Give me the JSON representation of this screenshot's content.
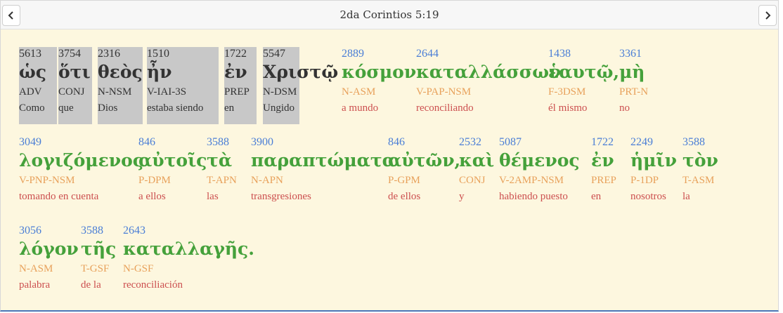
{
  "header": {
    "title": "2da Corintios 5:19",
    "prev_icon": "chevron-left-icon",
    "next_icon": "chevron-right-icon"
  },
  "colors": {
    "strong_number": "#4a7ed6",
    "greek_word": "#45a13b",
    "morphology": "#e8a15b",
    "gloss": "#cc4f4f",
    "selected_bg": "#c8c8c8",
    "panel_bg": "#fdf7df"
  },
  "rows": [
    [
      {
        "strong": "5613",
        "greek": "ὡς",
        "morph": "ADV",
        "gloss": "Como",
        "selected": true
      },
      {
        "strong": "3754",
        "greek": "ὅτι",
        "morph": "CONJ",
        "gloss": "que",
        "selected": true
      },
      {
        "strong": "2316",
        "greek": "θεὸς",
        "morph": "N-NSM",
        "gloss": "Dios",
        "selected": true
      },
      {
        "strong": "1510",
        "greek": "ἦν",
        "morph": "V-IAI-3S",
        "gloss": "estaba siendo",
        "selected": true
      },
      {
        "strong": "1722",
        "greek": "ἐν",
        "morph": "PREP",
        "gloss": "en",
        "selected": true
      },
      {
        "strong": "5547",
        "greek": "Χριστῷ",
        "morph": "N-DSM",
        "gloss": "Ungido",
        "selected": true
      },
      {
        "strong": "2889",
        "greek": "κόσμον",
        "morph": "N-ASM",
        "gloss": "a mundo",
        "selected": false
      },
      {
        "strong": "2644",
        "greek": "καταλλάσσων",
        "morph": "V-PAP-NSM",
        "gloss": "reconciliando",
        "selected": false
      },
      {
        "strong": "1438",
        "greek": "ἑαυτῷ,",
        "morph": "F-3DSM",
        "gloss": "él mismo",
        "selected": false
      },
      {
        "strong": "3361",
        "greek": "μὴ",
        "morph": "PRT-N",
        "gloss": "no",
        "selected": false
      }
    ],
    [
      {
        "strong": "3049",
        "greek": "λογιζόμενος",
        "morph": "V-PNP-NSM",
        "gloss": "tomando en cuenta",
        "selected": false
      },
      {
        "strong": "846",
        "greek": "αὐτοῖς",
        "morph": "P-DPM",
        "gloss": "a ellos",
        "selected": false
      },
      {
        "strong": "3588",
        "greek": "τὰ",
        "morph": "T-APN",
        "gloss": "las",
        "selected": false
      },
      {
        "strong": "3900",
        "greek": "παραπτώματα",
        "morph": "N-APN",
        "gloss": "transgresiones",
        "selected": false
      },
      {
        "strong": "846",
        "greek": "αὐτῶν,",
        "morph": "P-GPM",
        "gloss": "de ellos",
        "selected": false
      },
      {
        "strong": "2532",
        "greek": "καὶ",
        "morph": "CONJ",
        "gloss": "y",
        "selected": false
      },
      {
        "strong": "5087",
        "greek": "θέμενος",
        "morph": "V-2AMP-NSM",
        "gloss": "habiendo puesto",
        "selected": false
      },
      {
        "strong": "1722",
        "greek": "ἐν",
        "morph": "PREP",
        "gloss": "en",
        "selected": false
      },
      {
        "strong": "2249",
        "greek": "ἡμῖν",
        "morph": "P-1DP",
        "gloss": "nosotros",
        "selected": false
      },
      {
        "strong": "3588",
        "greek": "τὸν",
        "morph": "T-ASM",
        "gloss": "la",
        "selected": false
      }
    ],
    [
      {
        "strong": "3056",
        "greek": "λόγον",
        "morph": "N-ASM",
        "gloss": "palabra",
        "selected": false
      },
      {
        "strong": "3588",
        "greek": "τῆς",
        "morph": "T-GSF",
        "gloss": "de la",
        "selected": false
      },
      {
        "strong": "2643",
        "greek": "καταλλαγῆς.",
        "morph": "N-GSF",
        "gloss": "reconciliación",
        "selected": false
      }
    ]
  ]
}
